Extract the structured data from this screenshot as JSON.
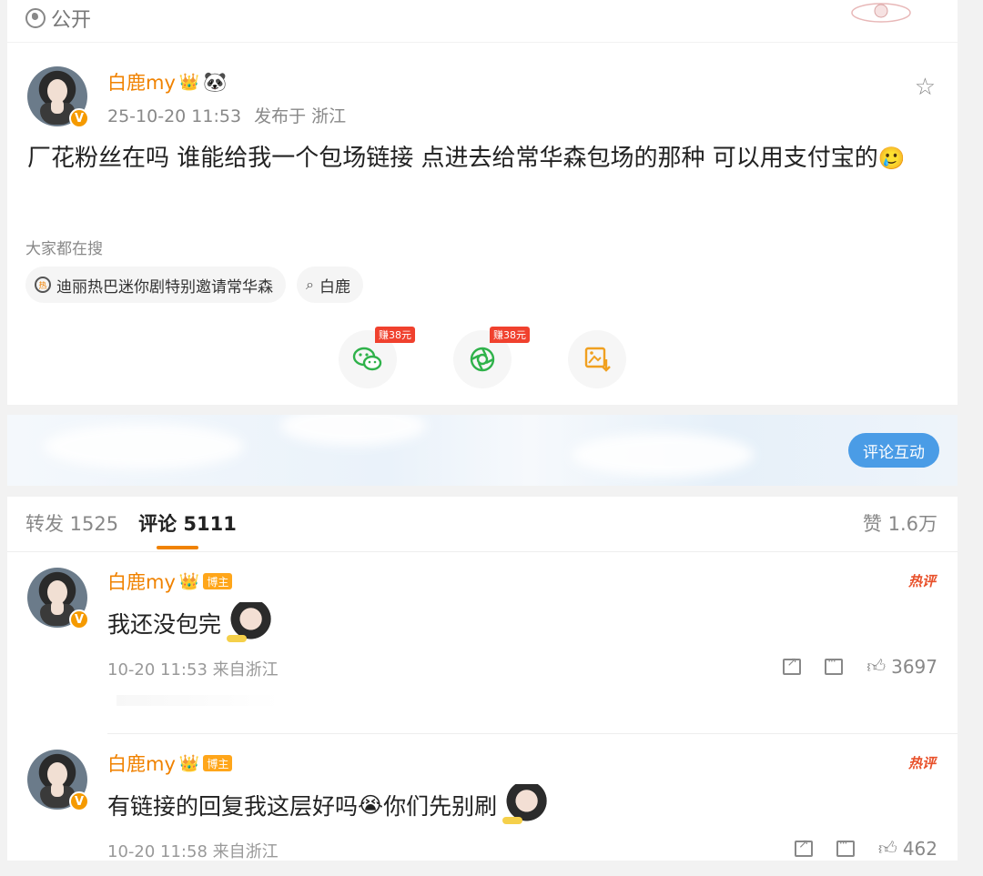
{
  "visibility": {
    "label": "公开"
  },
  "post": {
    "user": {
      "name": "白鹿my",
      "badge_emojis": "🐼",
      "verified_mark": "V"
    },
    "time": "25-10-20 11:53",
    "location": "发布于 浙江",
    "text": "厂花粉丝在吗 谁能给我一个包场链接 点进去给常华森包场的那种 可以用支付宝的",
    "text_emoji": "🥲"
  },
  "hot_search": {
    "label": "大家都在搜",
    "chips": [
      {
        "text": "迪丽热巴迷你剧特别邀请常华森",
        "icon": "hot-search-icon"
      },
      {
        "text": "白鹿",
        "icon": "search-icon"
      }
    ]
  },
  "share": {
    "buttons": [
      {
        "name": "wechat-share",
        "reward": "赚38元"
      },
      {
        "name": "moments-share",
        "reward": "赚38元"
      },
      {
        "name": "save-image",
        "reward": ""
      }
    ]
  },
  "banner": {
    "button": "评论互动"
  },
  "tabs": {
    "repost": "转发 1525",
    "comments": "评论 5111",
    "likes": "赞 1.6万"
  },
  "comments": [
    {
      "name": "白鹿my",
      "tag": "博主",
      "text": "我还没包完",
      "time": "10-20 11:53 来自浙江",
      "likes": "3697",
      "hot": "热评"
    },
    {
      "name": "白鹿my",
      "tag": "博主",
      "text_before": "有链接的回复我这层好吗",
      "text_emoji": "😭",
      "text_after": "你们先别刷",
      "time": "10-20 11:58 来自浙江",
      "likes": "462",
      "hot": "热评"
    }
  ],
  "colors": {
    "accent": "#f08200",
    "link_blue": "#4a9ce6",
    "reward_red": "#f0412e"
  }
}
